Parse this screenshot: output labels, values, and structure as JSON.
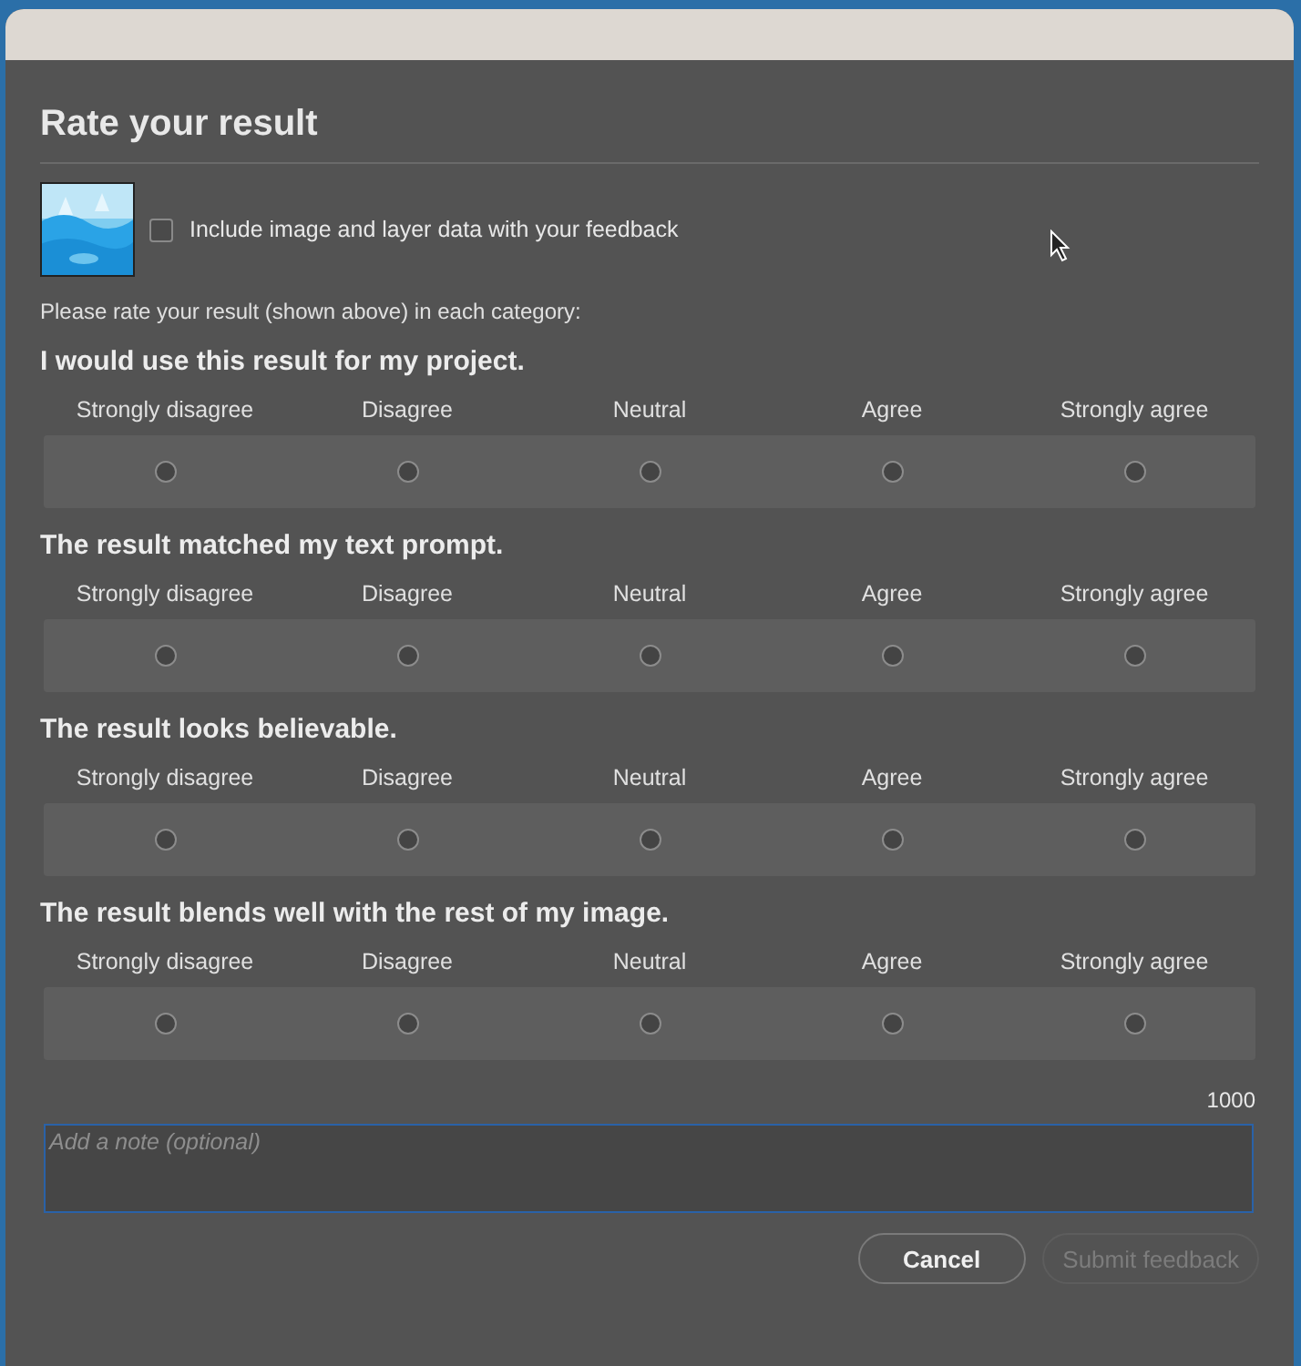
{
  "dialog": {
    "title": "Rate your result"
  },
  "include_data": {
    "label": "Include image and layer data with your feedback",
    "checked": false
  },
  "instruction": "Please rate your result (shown above) in each category:",
  "questions": [
    {
      "prompt": "I would use this result for my project.",
      "options": [
        {
          "label": "Strongly disagree",
          "selected": false
        },
        {
          "label": "Disagree",
          "selected": false
        },
        {
          "label": "Neutral",
          "selected": false
        },
        {
          "label": "Agree",
          "selected": false
        },
        {
          "label": "Strongly agree",
          "selected": false
        }
      ]
    },
    {
      "prompt": "The result matched my text prompt.",
      "options": [
        {
          "label": "Strongly disagree",
          "selected": false
        },
        {
          "label": "Disagree",
          "selected": false
        },
        {
          "label": "Neutral",
          "selected": false
        },
        {
          "label": "Agree",
          "selected": false
        },
        {
          "label": "Strongly agree",
          "selected": false
        }
      ]
    },
    {
      "prompt": "The result looks believable.",
      "options": [
        {
          "label": "Strongly disagree",
          "selected": false
        },
        {
          "label": "Disagree",
          "selected": false
        },
        {
          "label": "Neutral",
          "selected": false
        },
        {
          "label": "Agree",
          "selected": false
        },
        {
          "label": "Strongly agree",
          "selected": false
        }
      ]
    },
    {
      "prompt": "The result blends well with the rest of my image.",
      "options": [
        {
          "label": "Strongly disagree",
          "selected": false
        },
        {
          "label": "Disagree",
          "selected": false
        },
        {
          "label": "Neutral",
          "selected": false
        },
        {
          "label": "Agree",
          "selected": false
        },
        {
          "label": "Strongly agree",
          "selected": false
        }
      ]
    }
  ],
  "note": {
    "counter": "1000",
    "placeholder": "Add a note (optional)"
  },
  "buttons": [
    {
      "label": "Cancel",
      "disabled": false
    },
    {
      "label": "Submit feedback",
      "disabled": true
    }
  ]
}
